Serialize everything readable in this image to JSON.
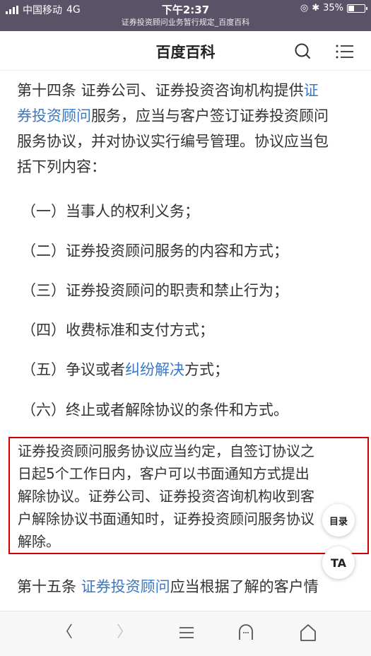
{
  "status_bar": {
    "carrier": "中国移动",
    "network": "4G",
    "time": "下午2:37",
    "subtitle": "证券投资顾问业务暂行规定_百度百科",
    "battery": "35%",
    "battery_level": 0.35
  },
  "header": {
    "title": "百度百科",
    "search_icon": "search-icon",
    "menu_icon": "menu-icon"
  },
  "article": {
    "para1_line1_prefix": "第十四条 证券公司、证券投资咨询机构提供",
    "para1_link1_part1": "证",
    "para1_link1_part2": "券投资顾问",
    "para1_line2_suffix": "服务，应当与客户签订证券投资顾问",
    "para1_line3": "服务协议，并对协议实行编号管理。协议应当包",
    "para1_line4": "括下列内容：",
    "list_items": [
      "（一）当事人的权利义务；",
      "（二）证券投资顾问服务的内容和方式；",
      "（三）证券投资顾问的职责和禁止行为；",
      "（四）收费标准和支付方式；"
    ],
    "item5_prefix": "（五）争议或者",
    "item5_link": "纠纷解决",
    "item5_suffix": "方式；",
    "item6": "（六）终止或者解除协议的条件和方式。",
    "highlight_lines": [
      "证券投资顾问服务协议应当约定，自签订协议之",
      "日起5个工作日内，客户可以书面通知方式提出",
      "解除协议。证券公司、证券投资咨询机构收到客",
      "户解除协议书面通知时，证券投资顾问服务协议",
      "解除。"
    ],
    "para15_prefix": "第十五条 ",
    "para15_link": "证券投资顾问",
    "para15_suffix": "应当根据了解的客户情"
  },
  "floating": {
    "toc_label": "目录",
    "ta_label": "TA"
  },
  "bottom_nav": {
    "back_label": "〈",
    "forward_label": "〉"
  },
  "colors": {
    "link": "#3a78c3",
    "highlight_border": "#cc0000",
    "status_bar_bg": "#5a5368"
  }
}
